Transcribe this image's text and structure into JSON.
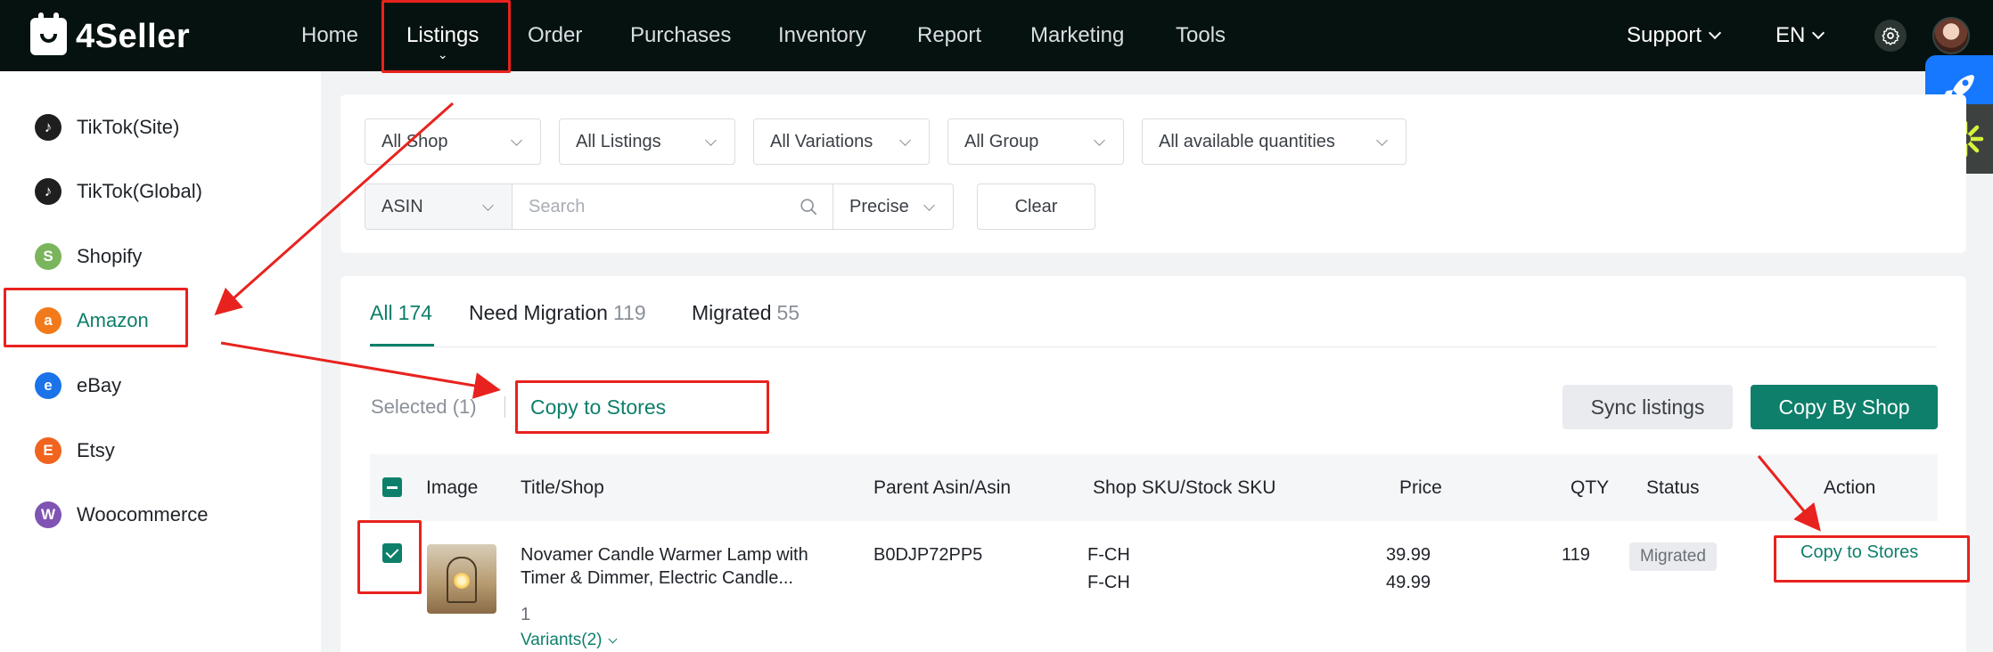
{
  "brand": {
    "name": "4Seller"
  },
  "nav": {
    "items": [
      {
        "label": "Home"
      },
      {
        "label": "Listings"
      },
      {
        "label": "Order"
      },
      {
        "label": "Purchases"
      },
      {
        "label": "Inventory"
      },
      {
        "label": "Report"
      },
      {
        "label": "Marketing"
      },
      {
        "label": "Tools"
      }
    ],
    "active": "Listings",
    "support_label": "Support",
    "language_label": "EN"
  },
  "sidebar": {
    "items": [
      {
        "label": "TikTok(Site)",
        "icon": "tiktok-icon",
        "color": "#1f1f1f"
      },
      {
        "label": "TikTok(Global)",
        "icon": "tiktok-icon",
        "color": "#1f1f1f"
      },
      {
        "label": "Shopify",
        "icon": "shopify-icon",
        "color": "#7ab55c"
      },
      {
        "label": "Amazon",
        "icon": "amazon-icon",
        "color": "#f27a1a"
      },
      {
        "label": "eBay",
        "icon": "ebay-icon",
        "color": "#1a73e8"
      },
      {
        "label": "Etsy",
        "icon": "etsy-icon",
        "color": "#f1641e"
      },
      {
        "label": "Woocommerce",
        "icon": "woocommerce-icon",
        "color": "#7f54b3"
      }
    ],
    "active": "Amazon"
  },
  "filters": {
    "shop": "All Shop",
    "listings": "All Listings",
    "variations": "All Variations",
    "group": "All Group",
    "quantities": "All available quantities",
    "search_field": "ASIN",
    "search_placeholder": "Search",
    "match_mode": "Precise",
    "clear_label": "Clear"
  },
  "tabs": [
    {
      "label": "All",
      "count": "174"
    },
    {
      "label": "Need Migration",
      "count": "119"
    },
    {
      "label": "Migrated",
      "count": "55"
    }
  ],
  "toolbar": {
    "selected_label": "Selected (1)",
    "copy_to_stores_label": "Copy to Stores",
    "sync_label": "Sync listings",
    "copy_by_shop_label": "Copy By Shop"
  },
  "table": {
    "columns": [
      "Image",
      "Title/Shop",
      "Parent Asin/Asin",
      "Shop SKU/Stock SKU",
      "Price",
      "QTY",
      "Status",
      "Action"
    ],
    "rows": [
      {
        "title_line1": "Novamer Candle Warmer Lamp with",
        "title_line2": "Timer & Dimmer, Electric Candle...",
        "shop_count": "1",
        "variants_label": "Variants(2)",
        "asin": "B0DJP72PP5",
        "sku1": "F-CH",
        "sku2": "F-CH",
        "price1": "39.99",
        "price2": "49.99",
        "qty": "119",
        "status": "Migrated",
        "action_label": "Copy to Stores"
      }
    ]
  },
  "colors": {
    "accent": "#0e7f6b",
    "annotation": "#e8221e",
    "topbar": "#06120f"
  }
}
